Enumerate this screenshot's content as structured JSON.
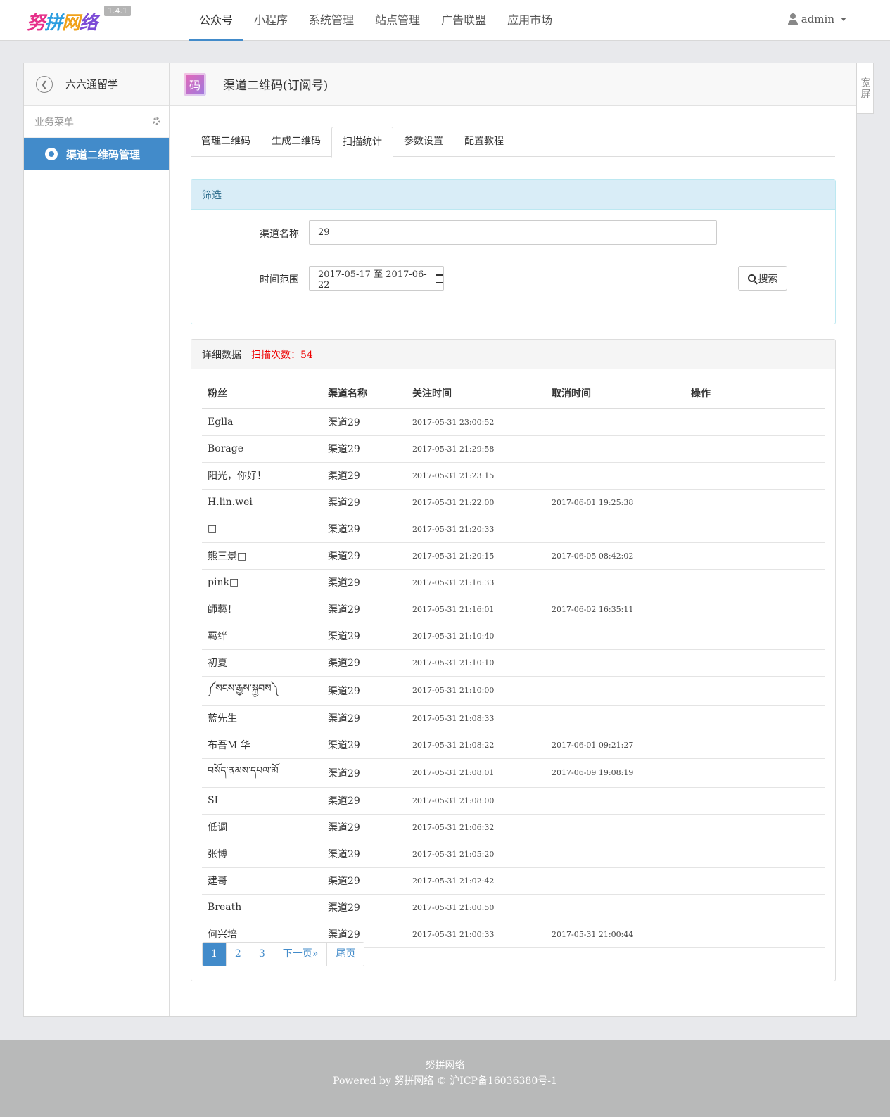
{
  "header": {
    "logo_parts": [
      "努",
      "拼",
      "网",
      "络"
    ],
    "version": "1.4.1",
    "nav": [
      "公众号",
      "小程序",
      "系统管理",
      "站点管理",
      "广告联盟",
      "应用市场"
    ],
    "active_nav": 0,
    "user": "admin"
  },
  "sidebar": {
    "account": "六六通留学",
    "menu_label": "业务菜单",
    "item": "渠道二维码管理"
  },
  "content": {
    "badge": "码",
    "title": "渠道二维码(订阅号)",
    "widescreen": "宽屏"
  },
  "tabs": [
    "管理二维码",
    "生成二维码",
    "扫描统计",
    "参数设置",
    "配置教程"
  ],
  "active_tab": 2,
  "filter": {
    "title": "筛选",
    "channel_label": "渠道名称",
    "channel_value": "29",
    "range_label": "时间范围",
    "range_value": "2017-05-17 至 2017-06-22",
    "search_label": "搜索"
  },
  "detail": {
    "title": "详细数据",
    "scan_count": "扫描次数：54",
    "columns": [
      "粉丝",
      "渠道名称",
      "关注时间",
      "取消时间",
      "操作"
    ],
    "rows": [
      [
        "Eglla",
        "渠道29",
        "2017-05-31 23:00:52",
        ""
      ],
      [
        "Borage",
        "渠道29",
        "2017-05-31 21:29:58",
        ""
      ],
      [
        "阳光，你好！",
        "渠道29",
        "2017-05-31 21:23:15",
        ""
      ],
      [
        "H.lin.wei",
        "渠道29",
        "2017-05-31 21:22:00",
        "2017-06-01 19:25:38"
      ],
      [
        "□",
        "渠道29",
        "2017-05-31 21:20:33",
        ""
      ],
      [
        "熊三景□",
        "渠道29",
        "2017-05-31 21:20:15",
        "2017-06-05 08:42:02"
      ],
      [
        "pink□",
        "渠道29",
        "2017-05-31 21:16:33",
        ""
      ],
      [
        "師藝！",
        "渠道29",
        "2017-05-31 21:16:01",
        "2017-06-02 16:35:11"
      ],
      [
        "羁绊",
        "渠道29",
        "2017-05-31 21:10:40",
        ""
      ],
      [
        "初夏",
        "渠道29",
        "2017-05-31 21:10:10",
        ""
      ],
      [
        "༼སངས་རྒྱས་སྐྱབས༽",
        "渠道29",
        "2017-05-31 21:10:00",
        ""
      ],
      [
        "蓝先生",
        "渠道29",
        "2017-05-31 21:08:33",
        ""
      ],
      [
        "布吾M 华",
        "渠道29",
        "2017-05-31 21:08:22",
        "2017-06-01 09:21:27"
      ],
      [
        "བསོད་ནམས་དཔལ་མོ",
        "渠道29",
        "2017-05-31 21:08:01",
        "2017-06-09 19:08:19"
      ],
      [
        "SI",
        "渠道29",
        "2017-05-31 21:08:00",
        ""
      ],
      [
        "低调",
        "渠道29",
        "2017-05-31 21:06:32",
        ""
      ],
      [
        "张博",
        "渠道29",
        "2017-05-31 21:05:20",
        ""
      ],
      [
        "建哥",
        "渠道29",
        "2017-05-31 21:02:42",
        ""
      ],
      [
        "Breath",
        "渠道29",
        "2017-05-31 21:00:50",
        ""
      ],
      [
        "何兴培",
        "渠道29",
        "2017-05-31 21:00:33",
        "2017-05-31 21:00:44"
      ]
    ]
  },
  "pager": [
    "1",
    "2",
    "3",
    "下一页»",
    "尾页"
  ],
  "active_page": 0,
  "footer": {
    "line1": "努拼网络",
    "line2": "Powered by 努拼网络 © 沪ICP备16036380号-1"
  }
}
